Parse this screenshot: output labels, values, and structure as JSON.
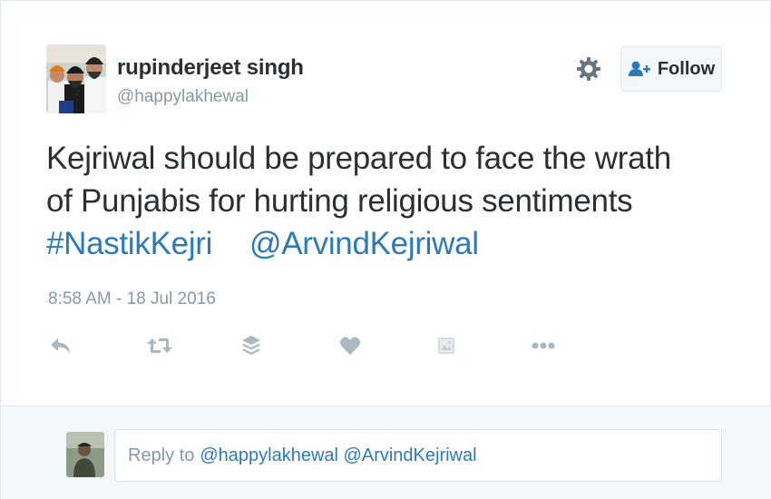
{
  "tweet": {
    "user": {
      "name": "rupinderjeet singh",
      "handle": "@happylakhewal"
    },
    "follow_label": "Follow",
    "text": {
      "line1": "Kejriwal should be prepared to face the wrath",
      "line2": "of Punjabis for hurting religious sentiments",
      "hashtag": "#NastikKejri",
      "mention": "@ArvindKejriwal"
    },
    "timestamp": "8:58 AM - 18 Jul 2016",
    "actions": [
      "reply-icon",
      "retweet-icon",
      "layers-icon",
      "heart-icon",
      "media-icon",
      "more-icon"
    ]
  },
  "reply": {
    "prefix": "Reply to",
    "mentions": "@happylakhewal @ArvindKejriwal"
  },
  "colors": {
    "link": "#2b7bb9",
    "text": "#292f33",
    "muted": "#8899a6",
    "icon": "#aab8c2",
    "reply_bg": "#f5f8fa"
  }
}
